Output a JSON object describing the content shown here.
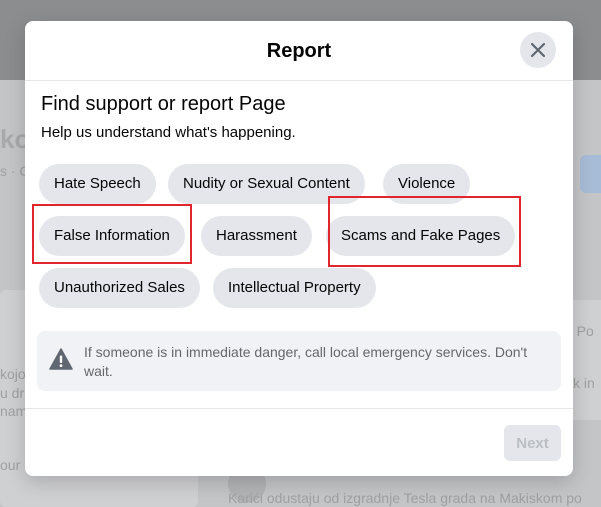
{
  "background": {
    "left_fragments": [
      "ko",
      "s · C",
      "kojo",
      "u drž",
      "nam",
      "our"
    ],
    "right_fragments": [
      "e Po",
      "k in"
    ],
    "bottom_post_text": "Karići odustaju od izgradnje Tesla grada na Makiskom po"
  },
  "modal": {
    "title": "Report",
    "close_icon": "close-icon",
    "heading": "Find support or report Page",
    "subheading": "Help us understand what's happening.",
    "options": [
      "Hate Speech",
      "Nudity or Sexual Content",
      "Violence",
      "False Information",
      "Harassment",
      "Scams and Fake Pages",
      "Unauthorized Sales",
      "Intellectual Property"
    ],
    "highlighted_options": [
      "False Information",
      "Scams and Fake Pages"
    ],
    "notice": {
      "icon": "warning-icon",
      "text": "If someone is in immediate danger, call local emergency services. Don't wait."
    },
    "next_label": "Next"
  },
  "colors": {
    "chip_bg": "#e4e6eb",
    "highlight_border": "#e0262c",
    "notice_bg": "#f0f2f5",
    "disabled_text": "#bcc0c4"
  }
}
